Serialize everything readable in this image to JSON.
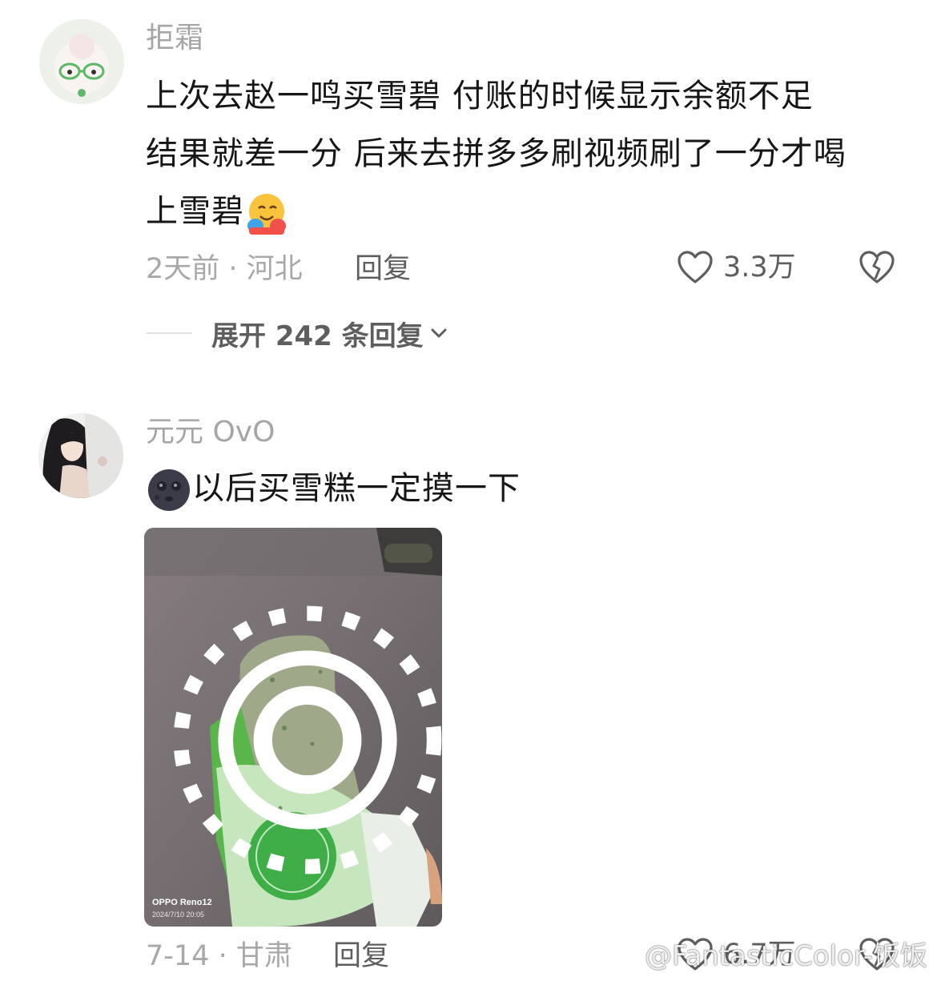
{
  "comments": [
    {
      "username": "拒霜",
      "text_lines": [
        "上次去赵一鸣买雪碧 付账的时候显示余额不足",
        "结果就差一分 后来去拼多多刷视频刷了一分才喝",
        "上雪碧"
      ],
      "emoji": "hugging-face",
      "time": "2天前",
      "location": "河北",
      "reply_label": "回复",
      "likes": "3.3万",
      "expand_label": "展开 242 条回复"
    },
    {
      "username": "元元 OvO",
      "emoji": "new-moon-face",
      "text": "以后买雪糕一定摸一下",
      "photo": {
        "brand": "OPPO Reno12",
        "date": "2024/7/10 20:05"
      },
      "time": "7-14",
      "location": "甘肃",
      "reply_label": "回复",
      "likes": "6.7万"
    }
  ],
  "watermark": "@FantasticColor-饭饭",
  "colors": {
    "text": "#161616",
    "muted": "#a6a6a6",
    "action": "#5e5e5e"
  }
}
